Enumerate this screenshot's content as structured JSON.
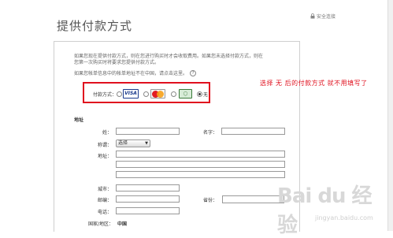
{
  "header": {
    "title": "提供付款方式",
    "secure_link": "安全连接"
  },
  "intro": {
    "text": "如果您现在提供付款方式，则在您进行购买时才会收取费用。如果您未选择付款方式，则在您第一次购买时将要求您提供付款方式。",
    "address_hint": "如果您帐单信息中的帐单地址不在中国，请点击这里。"
  },
  "payment": {
    "label": "付款方式：",
    "options": [
      "visa",
      "mastercard",
      "other-card",
      "none"
    ],
    "visa_text": "VISA",
    "other_text": "◯",
    "none_label": "无",
    "selected": "none"
  },
  "annotation": "选择 无 后的付款方式 就不用填写了",
  "address": {
    "section_title": "地址",
    "last_name_label": "姓：",
    "first_name_label": "名字：",
    "salutation_label": "称谓：",
    "salutation_value": "选择",
    "address_label": "地址：",
    "city_label": "城市：",
    "postcode_label": "邮编：",
    "province_label": "省份：",
    "phone_label": "电话：",
    "country_label": "国家/地区：",
    "country_value": "中国"
  },
  "watermark": {
    "brand": "Bai du 经验",
    "url": "jingyan.baidu.com"
  }
}
